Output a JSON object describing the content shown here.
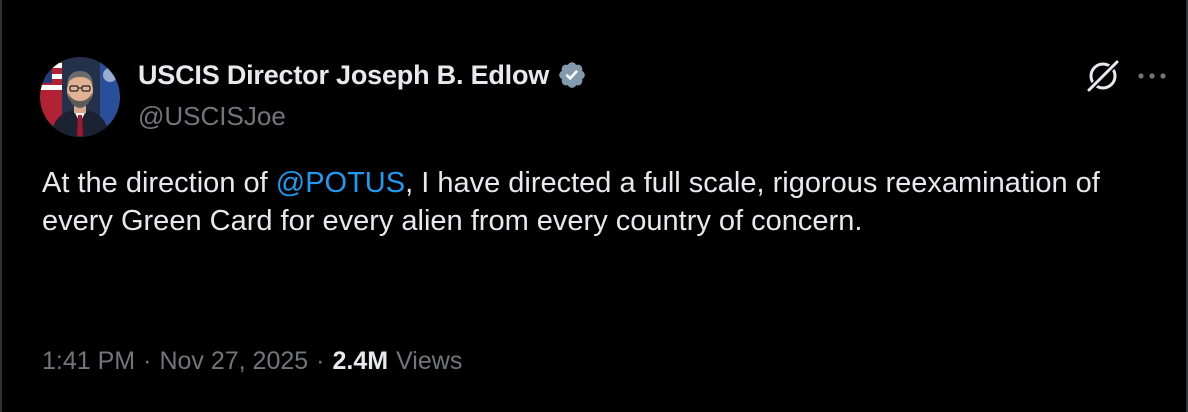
{
  "author": {
    "display_name": "USCIS Director Joseph B. Edlow",
    "handle": "@USCISJoe",
    "verified_badge_icon": "verified-badge-icon",
    "badge_color": "#829aab"
  },
  "tweet": {
    "text_before_mention": "At the direction of ",
    "mention": "@POTUS",
    "text_after_mention": ", I have directed a full scale, rigorous reexamination of every Green Card for every alien from every country of concern."
  },
  "meta": {
    "time": "1:41 PM",
    "separator": "·",
    "date": "Nov 27, 2025",
    "views_count": "2.4M",
    "views_label": "Views"
  },
  "icons": {
    "grok": "grok-icon",
    "more": "more-icon"
  },
  "colors": {
    "background": "#000000",
    "text_primary": "#e7e9ea",
    "text_secondary": "#71767b",
    "link": "#1d9bf0"
  }
}
